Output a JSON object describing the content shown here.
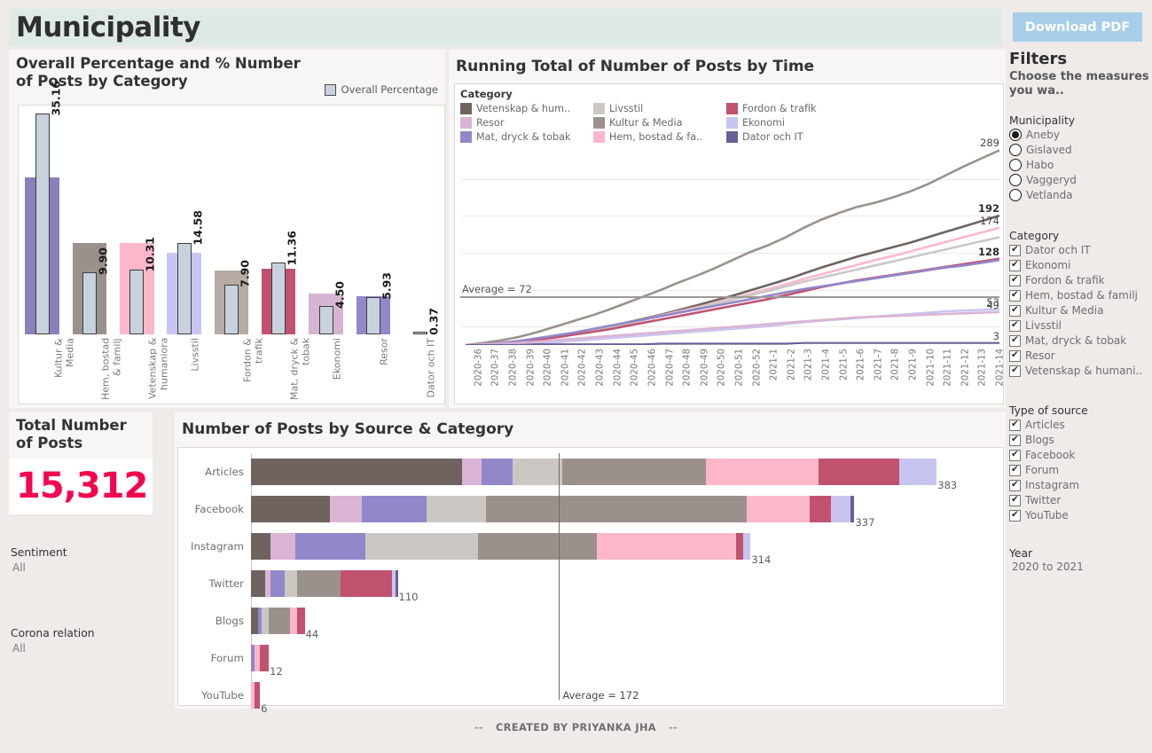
{
  "header": {
    "title": "Municipality",
    "download_label": "Download PDF",
    "accent_title_bg": "#dfeae6",
    "download_bg": "#a6cee8"
  },
  "bar_panel": {
    "title": "Overall Percentage and % Number of Posts by Category",
    "legend_label": "Overall Percentage"
  },
  "line_panel": {
    "title": "Running Total of Number of Posts by Time",
    "legend_title": "Category"
  },
  "stack_panel": {
    "title": "Number of Posts by Source & Category"
  },
  "total_panel": {
    "title": "Total Number of Posts",
    "value": "15,312",
    "value_color": "#f5054f"
  },
  "side_notes": [
    {
      "label": "Sentiment",
      "value": "All"
    },
    {
      "label": "Corona relation",
      "value": "All"
    }
  ],
  "filters": {
    "title": "Filters",
    "subtitle": "Choose the measures you wa..",
    "municipality": {
      "title": "Municipality",
      "options": [
        "Aneby",
        "Gislaved",
        "Habo",
        "Vaggeryd",
        "Vetlanda"
      ],
      "selected": "Aneby"
    },
    "category": {
      "title": "Category",
      "options": [
        {
          "label": "Dator och IT",
          "checked": true
        },
        {
          "label": "Ekonomi",
          "checked": true
        },
        {
          "label": "Fordon & trafik",
          "checked": true
        },
        {
          "label": "Hem, bostad & familj",
          "checked": true
        },
        {
          "label": "Kultur & Media",
          "checked": true
        },
        {
          "label": "Livsstil",
          "checked": true
        },
        {
          "label": "Mat, dryck & tobak",
          "checked": true
        },
        {
          "label": "Resor",
          "checked": true
        },
        {
          "label": "Vetenskap & humani..",
          "checked": true
        }
      ]
    },
    "source": {
      "title": "Type of source",
      "options": [
        {
          "label": "Articles",
          "checked": true
        },
        {
          "label": "Blogs",
          "checked": true
        },
        {
          "label": "Facebook",
          "checked": true
        },
        {
          "label": "Forum",
          "checked": true
        },
        {
          "label": "Instagram",
          "checked": true
        },
        {
          "label": "Twitter",
          "checked": true
        },
        {
          "label": "YouTube",
          "checked": true
        }
      ]
    },
    "year": {
      "title": "Year",
      "value": "2020 to 2021"
    }
  },
  "footer": {
    "text": "CREATED BY PRIYANKA JHA",
    "dash": "--"
  },
  "category_colors": {
    "Vetenskap & humaniora": "#6f6360",
    "Livsstil": "#cbc8c4",
    "Fordon & trafik": "#c0526f",
    "Resor": "#dab4d3",
    "Kultur & Media": "#9b918c",
    "Ekonomi": "#c8c5f0",
    "Mat, dryck & tobak": "#9187c9",
    "Hem, bostad & familj": "#fdb7cb",
    "Dator och IT": "#6a5f96"
  },
  "chart_data": [
    {
      "type": "bar",
      "title": "Overall Percentage and % Number of Posts by Category",
      "xlabel": "",
      "ylabel": "",
      "ylim": [
        0,
        36
      ],
      "grid": false,
      "legend": [
        "Overall Percentage"
      ],
      "legend_position": "top-right",
      "categories": [
        "Kultur & Media",
        "Hem, bostad & familj",
        "Vetenskap & humaniora",
        "Livsstil",
        "Fordon & trafik",
        "Mat, dryck & tobak",
        "Ekonomi",
        "Resor",
        "Dator och IT"
      ],
      "series": [
        {
          "name": "% Number of Posts",
          "values": [
            25.0,
            14.5,
            14.5,
            13.0,
            10.2,
            10.5,
            6.5,
            6.0,
            0.2
          ],
          "colors": [
            "#8b80b9",
            "#9b918c",
            "#fdb7cb",
            "#c8c5f0",
            "#b6aba5",
            "#c0526f",
            "#d6b4d2",
            "#9187c9",
            "#ffffff"
          ]
        },
        {
          "name": "Overall Percentage",
          "values": [
            35.16,
            9.9,
            10.31,
            14.58,
            7.9,
            11.36,
            4.5,
            5.93,
            0.37
          ],
          "color": "#c7d2dd"
        }
      ],
      "data_labels": [
        "35.16",
        "9.90",
        "10.31",
        "14.58",
        "7.90",
        "11.36",
        "4.50",
        "5.93",
        "0.37"
      ]
    },
    {
      "type": "line",
      "title": "Running Total of Number of Posts by Time",
      "xlabel": "",
      "ylabel": "",
      "grid": true,
      "legend_position": "top",
      "legend_title": "Category",
      "reference_line": {
        "label": "Average = 72",
        "value": 72
      },
      "ylim": [
        0,
        300
      ],
      "x": [
        "2021-14",
        "2021-13",
        "2021-12",
        "2021-11",
        "2021-10",
        "2021-9",
        "2021-8",
        "2021-7",
        "2021-6",
        "2021-5",
        "2021-4",
        "2021-3",
        "2021-2",
        "2021-1",
        "2020-52",
        "2020-51",
        "2020-50",
        "2020-49",
        "2020-48",
        "2020-47",
        "2020-46",
        "2020-45",
        "2020-44",
        "2020-43",
        "2020-42",
        "2020-41",
        "2020-40",
        "2020-39",
        "2020-38",
        "2020-37",
        "2020-36"
      ],
      "end_labels": [
        {
          "value": "289",
          "series": "Kultur & Media",
          "bold": false
        },
        {
          "value": "192",
          "series": "Vetenskap & humaniora",
          "bold": true
        },
        {
          "value": "174",
          "series": "Hem, bostad & familj",
          "bold": false
        },
        {
          "value": "128",
          "series": "Fordon & trafik",
          "bold": true
        },
        {
          "value": "53",
          "series": "Ekonomi",
          "bold": false
        },
        {
          "value": "49",
          "series": "Resor",
          "bold": false
        },
        {
          "value": "3",
          "series": "Dator och IT",
          "bold": false
        }
      ],
      "series": [
        {
          "name": "Kultur & Media",
          "color": "#9b918c",
          "end_value": 289,
          "values": [
            289,
            277,
            265,
            252,
            239,
            228,
            219,
            211,
            205,
            196,
            186,
            174,
            160,
            148,
            138,
            126,
            114,
            103,
            93,
            82,
            72,
            62,
            52,
            43,
            35,
            27,
            19,
            12,
            7,
            3,
            0
          ]
        },
        {
          "name": "Vetenskap & humaniora",
          "color": "#6f6360",
          "end_value": 192,
          "values": [
            192,
            184,
            176,
            168,
            160,
            152,
            145,
            138,
            131,
            123,
            115,
            106,
            97,
            89,
            81,
            73,
            66,
            59,
            52,
            45,
            39,
            33,
            27,
            22,
            17,
            13,
            9,
            6,
            3,
            1,
            0
          ]
        },
        {
          "name": "Hem, bostad & familj",
          "color": "#fdb7cb",
          "end_value": 174,
          "values": [
            174,
            167,
            160,
            153,
            146,
            139,
            132,
            126,
            119,
            112,
            105,
            98,
            90,
            83,
            76,
            69,
            62,
            56,
            50,
            44,
            38,
            32,
            27,
            22,
            17,
            13,
            9,
            6,
            3,
            1,
            0
          ]
        },
        {
          "name": "Livsstil",
          "color": "#cbc8c4",
          "end_value": 160,
          "values": [
            160,
            154,
            148,
            142,
            136,
            130,
            124,
            118,
            112,
            106,
            100,
            94,
            87,
            80,
            74,
            67,
            61,
            55,
            49,
            43,
            37,
            31,
            26,
            21,
            17,
            13,
            9,
            6,
            3,
            1,
            0
          ]
        },
        {
          "name": "Fordon & trafik",
          "color": "#c0526f",
          "end_value": 128,
          "values": [
            128,
            124,
            120,
            116,
            112,
            108,
            104,
            100,
            96,
            91,
            86,
            80,
            74,
            68,
            63,
            58,
            53,
            48,
            43,
            38,
            33,
            28,
            23,
            19,
            15,
            11,
            8,
            5,
            3,
            1,
            0
          ]
        },
        {
          "name": "Mat, dryck & tobak",
          "color": "#9187c9",
          "end_value": 126,
          "values": [
            126,
            122,
            118,
            115,
            111,
            107,
            103,
            99,
            95,
            91,
            87,
            83,
            78,
            73,
            68,
            63,
            58,
            53,
            48,
            43,
            38,
            33,
            28,
            23,
            18,
            14,
            10,
            6,
            3,
            1,
            0
          ]
        },
        {
          "name": "Ekonomi",
          "color": "#c8c5f0",
          "end_value": 53,
          "values": [
            53,
            52,
            51,
            50,
            48,
            46,
            44,
            42,
            40,
            38,
            36,
            34,
            31,
            28,
            26,
            24,
            22,
            20,
            18,
            16,
            14,
            12,
            10,
            8,
            6,
            4,
            3,
            2,
            1,
            0,
            0
          ]
        },
        {
          "name": "Resor",
          "color": "#dab4d3",
          "end_value": 49,
          "values": [
            49,
            48,
            47,
            46,
            45,
            44,
            43,
            42,
            41,
            39,
            37,
            35,
            33,
            31,
            29,
            27,
            25,
            23,
            21,
            19,
            17,
            15,
            13,
            11,
            9,
            7,
            5,
            3,
            2,
            1,
            0
          ]
        },
        {
          "name": "Dator och IT",
          "color": "#6a5f96",
          "end_value": 3,
          "values": [
            3,
            3,
            3,
            3,
            3,
            3,
            3,
            3,
            3,
            3,
            3,
            3,
            2,
            2,
            2,
            2,
            2,
            2,
            2,
            2,
            1,
            1,
            1,
            1,
            1,
            1,
            1,
            0,
            0,
            0,
            0
          ]
        }
      ]
    },
    {
      "type": "bar",
      "orientation": "horizontal",
      "stacked": true,
      "title": "Number of Posts by Source & Category",
      "xlabel": "",
      "ylabel": "",
      "grid": false,
      "reference_line": {
        "label": "Average = 172",
        "value": 172
      },
      "xlim": [
        0,
        400
      ],
      "categories": [
        "Articles",
        "Facebook",
        "Instagram",
        "Twitter",
        "Blogs",
        "Forum",
        "YouTube"
      ],
      "totals": [
        383,
        337,
        314,
        110,
        44,
        12,
        6
      ],
      "stack_order": [
        "Vetenskap & humaniora",
        "Resor",
        "Mat, dryck & tobak",
        "Livsstil",
        "Kultur & Media",
        "Hem, bostad & familj",
        "Fordon & trafik",
        "Ekonomi",
        "Dator och IT"
      ],
      "rows": [
        {
          "source": "Articles",
          "total": 383,
          "segments": [
            {
              "category": "Vetenskap & humaniora",
              "value": 118
            },
            {
              "category": "Resor",
              "value": 11
            },
            {
              "category": "Mat, dryck & tobak",
              "value": 17
            },
            {
              "category": "Livsstil",
              "value": 28
            },
            {
              "category": "Kultur & Media",
              "value": 80
            },
            {
              "category": "Hem, bostad & familj",
              "value": 63
            },
            {
              "category": "Fordon & trafik",
              "value": 45
            },
            {
              "category": "Ekonomi",
              "value": 21
            }
          ]
        },
        {
          "source": "Facebook",
          "total": 337,
          "segments": [
            {
              "category": "Vetenskap & humaniora",
              "value": 44
            },
            {
              "category": "Resor",
              "value": 18
            },
            {
              "category": "Mat, dryck & tobak",
              "value": 36
            },
            {
              "category": "Livsstil",
              "value": 33
            },
            {
              "category": "Kultur & Media",
              "value": 146
            },
            {
              "category": "Hem, bostad & familj",
              "value": 35
            },
            {
              "category": "Fordon & trafik",
              "value": 12
            },
            {
              "category": "Ekonomi",
              "value": 11
            },
            {
              "category": "Dator och IT",
              "value": 2
            }
          ]
        },
        {
          "source": "Instagram",
          "total": 314,
          "segments": [
            {
              "category": "Vetenskap & humaniora",
              "value": 11
            },
            {
              "category": "Resor",
              "value": 14
            },
            {
              "category": "Mat, dryck & tobak",
              "value": 39
            },
            {
              "category": "Livsstil",
              "value": 63
            },
            {
              "category": "Kultur & Media",
              "value": 66
            },
            {
              "category": "Hem, bostad & familj",
              "value": 78
            },
            {
              "category": "Fordon & trafik",
              "value": 4
            },
            {
              "category": "Ekonomi",
              "value": 4
            }
          ]
        },
        {
          "source": "Twitter",
          "total": 110,
          "segments": [
            {
              "category": "Vetenskap & humaniora",
              "value": 8
            },
            {
              "category": "Resor",
              "value": 3
            },
            {
              "category": "Mat, dryck & tobak",
              "value": 8
            },
            {
              "category": "Livsstil",
              "value": 7
            },
            {
              "category": "Kultur & Media",
              "value": 24
            },
            {
              "category": "Fordon & trafik",
              "value": 29
            },
            {
              "category": "Ekonomi",
              "value": 2
            },
            {
              "category": "Dator och IT",
              "value": 1
            }
          ]
        },
        {
          "source": "Blogs",
          "total": 44,
          "segments": [
            {
              "category": "Vetenskap & humaniora",
              "value": 4
            },
            {
              "category": "Mat, dryck & tobak",
              "value": 2
            },
            {
              "category": "Livsstil",
              "value": 4
            },
            {
              "category": "Kultur & Media",
              "value": 12
            },
            {
              "category": "Hem, bostad & familj",
              "value": 4
            },
            {
              "category": "Fordon & trafik",
              "value": 4
            }
          ]
        },
        {
          "source": "Forum",
          "total": 12,
          "segments": [
            {
              "category": "Mat, dryck & tobak",
              "value": 2
            },
            {
              "category": "Hem, bostad & familj",
              "value": 3
            },
            {
              "category": "Fordon & trafik",
              "value": 5
            }
          ]
        },
        {
          "source": "YouTube",
          "total": 6,
          "segments": [
            {
              "category": "Hem, bostad & familj",
              "value": 2
            },
            {
              "category": "Fordon & trafik",
              "value": 3
            }
          ]
        }
      ]
    }
  ]
}
